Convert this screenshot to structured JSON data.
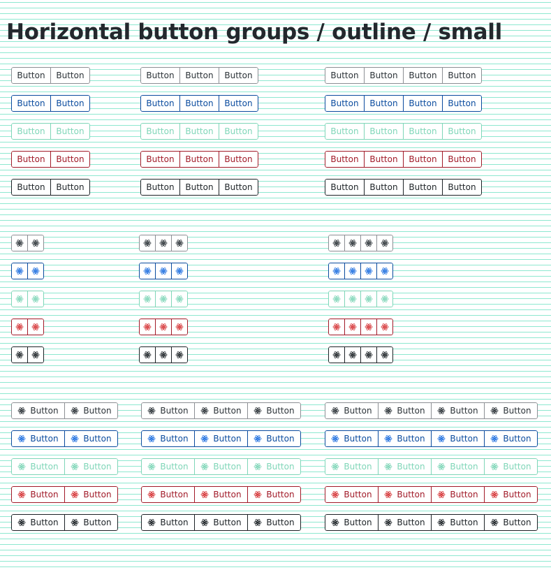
{
  "page_title": "Horizontal button groups / outline / small",
  "button_label": "Button",
  "icon_name": "atom-icon",
  "variants": [
    "default",
    "primary",
    "light",
    "danger",
    "dark"
  ],
  "colors": {
    "default": "#2c3338",
    "primary": "#0a4b9e",
    "light": "#7fd6b8",
    "danger": "#a11a28",
    "dark": "#1d2327",
    "stripes": "#8ee8d0"
  },
  "sections": [
    {
      "kind": "text",
      "group_sizes": [
        2,
        3,
        4
      ]
    },
    {
      "kind": "icon",
      "group_sizes": [
        2,
        3,
        4
      ]
    },
    {
      "kind": "icon-text",
      "group_sizes": [
        2,
        3,
        4
      ]
    }
  ]
}
